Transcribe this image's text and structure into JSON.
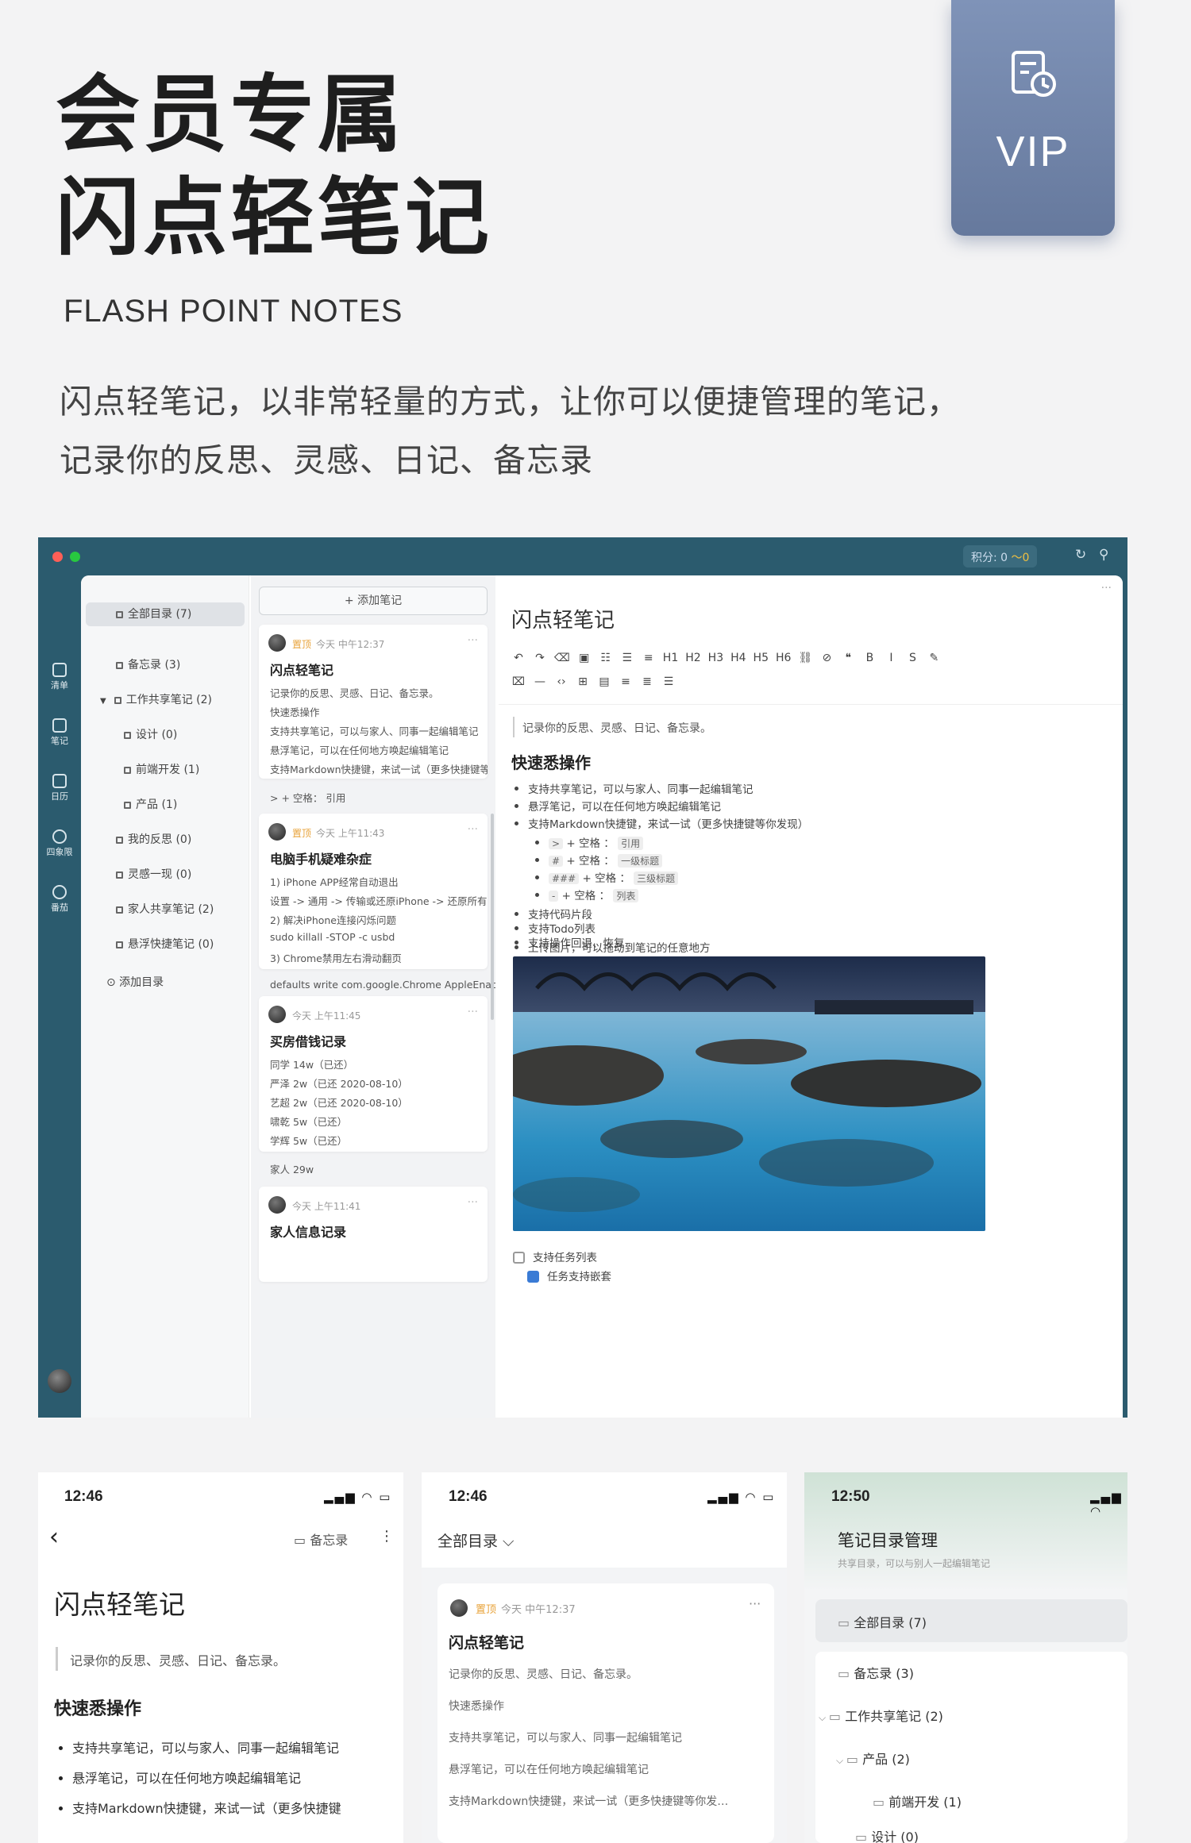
{
  "hero": {
    "title_line1": "会员专属",
    "title_line2": "闪点轻笔记",
    "subtitle_en": "FLASH POINT NOTES",
    "desc_line1": "闪点轻笔记，以非常轻量的方式，让你可以便捷管理的笔记，",
    "desc_line2": "记录你的反思、灵感、日记、备忘录"
  },
  "vip_badge": {
    "label": "VIP",
    "icon": "note-clock-icon"
  },
  "desktop": {
    "score_label": "积分: 0",
    "streak_label": "〜0",
    "rail": [
      {
        "label": "清单",
        "icon": "list-icon"
      },
      {
        "label": "笔记",
        "icon": "note-icon"
      },
      {
        "label": "日历",
        "icon": "calendar-icon"
      },
      {
        "label": "四象限",
        "icon": "quadrant-icon"
      },
      {
        "label": "番茄",
        "icon": "tomato-icon"
      }
    ],
    "dir": {
      "items": [
        "全部目录 (7)",
        "备忘录 (3)",
        "工作共享笔记 (2)",
        "设计 (0)",
        "前端开发 (1)",
        "产品 (1)",
        "我的反思 (0)",
        "灵感一现 (0)",
        "家人共享笔记 (2)",
        "悬浮快捷笔记 (0)"
      ],
      "add_label": "⊙ 添加目录"
    },
    "add_note_label": "+ 添加笔记",
    "cards": [
      {
        "pin": "置顶",
        "time": "今天 中午12:37",
        "title": "闪点轻笔记",
        "lines": [
          "记录你的反思、灵感、日记、备忘录。",
          "快速悉操作",
          "支持共享笔记，可以与家人、同事一起编辑笔记",
          "悬浮笔记，可以在任何地方唤起编辑笔记",
          "支持Markdown快捷键，来试一试（更多快捷键等你发现）",
          "> + 空格： 引用"
        ]
      },
      {
        "pin": "置顶",
        "time": "今天 上午11:43",
        "title": "电脑手机疑难杂症",
        "lines": [
          "1) iPhone APP经常自动退出",
          "设置 -> 通用 -> 传输或还原iPhone -> 还原所有设置",
          "2) 解决iPhone连接闪烁问题",
          "sudo killall -STOP -c usbd",
          "3) Chrome禁用左右滑动翻页",
          "defaults write com.google.Chrome AppleEnableSwipeNa"
        ]
      },
      {
        "pin": "",
        "time": "今天 上午11:45",
        "title": "买房借钱记录",
        "lines": [
          "同学 14w（已还）",
          "严泽 2w（已还 2020-08-10）",
          "艺超 2w（已还 2020-08-10）",
          "啸乾 5w（已还）",
          "学辉 5w（已还）",
          "家人 29w"
        ]
      },
      {
        "pin": "",
        "time": "今天 上午11:41",
        "title": "家人信息记录",
        "lines": []
      }
    ],
    "editor": {
      "title": "闪点轻笔记",
      "toolbar_row1": [
        "↶",
        "↷",
        "⌫",
        "▣",
        "☷",
        "☰",
        "≡",
        "H1",
        "H2",
        "H3",
        "H4",
        "H5",
        "H6",
        "⛓",
        "⊘",
        "❝",
        "B",
        "I",
        "S",
        "✎"
      ],
      "toolbar_row2": [
        "⌧",
        "—",
        "‹›",
        "⊞",
        "▤",
        "≡",
        "≣",
        "☰"
      ],
      "quote": "记录你的反思、灵感、日记、备忘录。",
      "heading": "快速悉操作",
      "bullets": [
        "支持共享笔记，可以与家人、同事一起编辑笔记",
        "悬浮笔记，可以在任何地方唤起编辑笔记",
        "支持Markdown快捷键，来试一试（更多快捷键等你发现）"
      ],
      "sub_bullets": [
        {
          "key": ">",
          "text": "+ 空格 ：",
          "value": "引用"
        },
        {
          "key": "#",
          "text": "+ 空格 ：",
          "value": "一级标题"
        },
        {
          "key": "###",
          "text": "+ 空格 ：",
          "value": "三级标题"
        },
        {
          "key": "-",
          "text": "+ 空格 ：",
          "value": "列表"
        }
      ],
      "bullets2": [
        "支持代码片段",
        "支持Todo列表",
        "支持操作回退、恢复",
        "上传图片，可以拖动到笔记的任意地方"
      ],
      "todo1": "支持任务列表",
      "todo2": "任务支持嵌套"
    }
  },
  "phones": [
    {
      "time": "12:46",
      "folder": "备忘录",
      "title": "闪点轻笔记",
      "quote": "记录你的反思、灵感、日记、备忘录。",
      "heading": "快速悉操作",
      "bullets": [
        "支持共享笔记，可以与家人、同事一起编辑笔记",
        "悬浮笔记，可以在任何地方唤起编辑笔记",
        "支持Markdown快捷键，来试一试（更多快捷键"
      ]
    },
    {
      "time": "12:46",
      "dir_label": "全部目录 ⌵",
      "card_pin": "置顶",
      "card_time": "今天 中午12:37",
      "card_title": "闪点轻笔记",
      "card_lines": [
        "记录你的反思、灵感、日记、备忘录。",
        "快速悉操作",
        "支持共享笔记，可以与家人、同事一起编辑笔记",
        "悬浮笔记，可以在任何地方唤起编辑笔记",
        "支持Markdown快捷键，来试一试（更多快捷键等你发…"
      ]
    },
    {
      "time": "12:50",
      "title": "笔记目录管理",
      "subtitle": "共享目录，可以与别人一起编辑笔记",
      "items": [
        "全部目录 (7)",
        "备忘录 (3)",
        "工作共享笔记 (2)",
        "产品 (2)",
        "前端开发 (1)",
        "设计 (0)"
      ]
    }
  ]
}
